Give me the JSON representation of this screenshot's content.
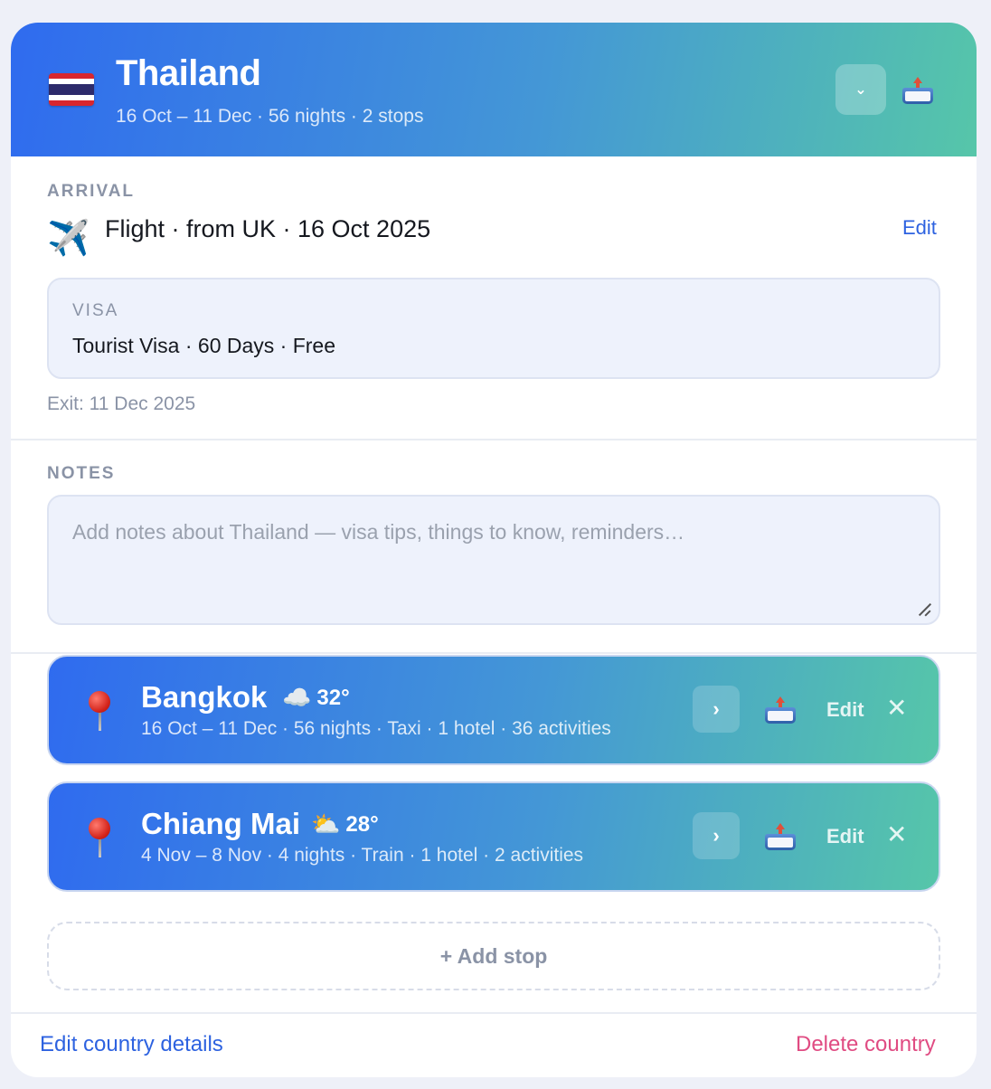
{
  "country": {
    "name": "Thailand",
    "subtitle": "16 Oct – 11 Dec · 56 nights · 2 stops",
    "collapse_icon": "chevron-down-icon",
    "export_icon": "outbox-tray-icon"
  },
  "arrival": {
    "label": "ARRIVAL",
    "icon": "airplane-icon",
    "text": "Flight · from UK · 16 Oct 2025",
    "edit_label": "Edit"
  },
  "visa": {
    "label": "VISA",
    "value": "Tourist Visa · 60 Days · Free"
  },
  "exit_text": "Exit: 11 Dec 2025",
  "notes": {
    "label": "NOTES",
    "placeholder": "Add notes about Thailand — visa tips, things to know, reminders…"
  },
  "stops": [
    {
      "name": "Bangkok",
      "weather_icon": "cloud-icon",
      "weather_glyph": "☁️",
      "temp": "32°",
      "subtitle": "16 Oct – 11 Dec · 56 nights · Taxi · 1 hotel · 36 activities",
      "edit_label": "Edit"
    },
    {
      "name": "Chiang Mai",
      "weather_icon": "sun-behind-cloud-icon",
      "weather_glyph": "⛅",
      "temp": "28°",
      "subtitle": "4 Nov – 8 Nov · 4 nights · Train · 1 hotel · 2 activities",
      "edit_label": "Edit"
    }
  ],
  "add_stop_label": "+ Add stop",
  "footer": {
    "edit_country_label": "Edit country details",
    "delete_country_label": "Delete country"
  },
  "colors": {
    "gradient_start": "#2f6bef",
    "gradient_end": "#56c6a9",
    "link_blue": "#2d62e0",
    "danger_pink": "#e04b82"
  }
}
